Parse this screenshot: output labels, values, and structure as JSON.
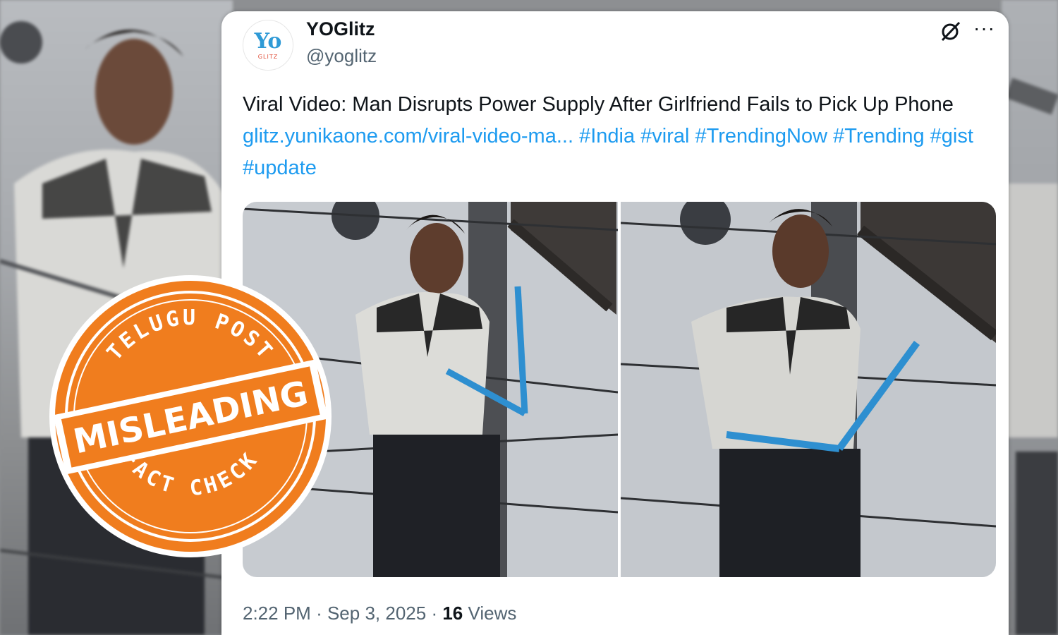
{
  "tweet": {
    "author_name": "YOGlitz",
    "handle": "@yoglitz",
    "avatar_text": "Yo",
    "avatar_subtext": "GLITZ",
    "text_plain": "Viral Video: Man Disrupts Power Supply After Girlfriend Fails to Pick Up Phone ",
    "link": "glitz.yunikaone.com/viral-video-ma...",
    "hashtags": "#India #viral #TrendingNow #Trending #gist #update",
    "time": "2:22 PM",
    "date": "Sep 3, 2025",
    "views_count": "16",
    "views_label": "Views",
    "more_label": "···"
  },
  "stamp": {
    "top_text": "TELUGU POST",
    "verdict": "MISLEADING",
    "bottom_text": "FACT CHECK",
    "color": "#f07d1e"
  },
  "icons": [
    "grok-icon",
    "more-icon"
  ],
  "colors": {
    "link": "#1d9bf0",
    "text": "#0f1419",
    "muted": "#536471"
  }
}
